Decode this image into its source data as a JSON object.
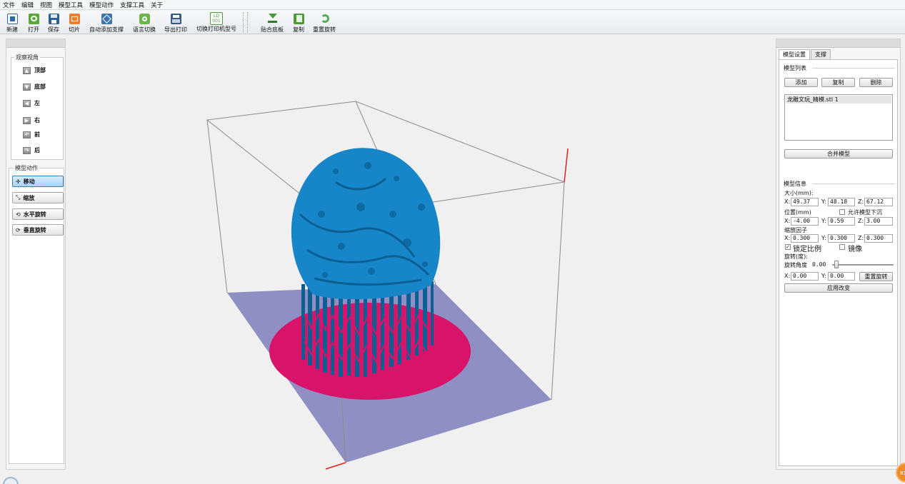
{
  "menu": [
    "文件",
    "编辑",
    "视图",
    "模型工具",
    "模型动作",
    "支撑工具",
    "关于"
  ],
  "toolbar": {
    "new": "新建",
    "open": "打开",
    "save": "保存",
    "slice": "切片",
    "auto_support": "自动添加支撑",
    "language": "语言切换",
    "export_print": "导出打印",
    "switch_printer": "切换打印机型号",
    "lay_flat": "贴合底板",
    "copy": "复制",
    "reset_rotation": "重置旋转",
    "printer_icon_text": "LD\n001",
    "colors": {
      "new": "#2e6aa8",
      "open": "#5aa83a",
      "save": "#2f5f8e",
      "slice": "#ee7d2d",
      "auto_support": "#3f74a8",
      "language": "#6ab44a",
      "export": "#3a5a80",
      "flat": "#4a9a3a",
      "copy": "#4f9a38",
      "reset": "#5aab55"
    }
  },
  "left_panel": {
    "view_group_title": "观察视角",
    "views": [
      "顶部",
      "底部",
      "左",
      "右",
      "前",
      "后"
    ],
    "action_group_title": "模型动作",
    "actions": [
      "移动",
      "缩放",
      "水平旋转",
      "垂直旋转"
    ]
  },
  "right_panel": {
    "tabs": [
      "模型设置",
      "支撑"
    ],
    "model_list_title": "模型列表",
    "add_button": "添加",
    "copy_button": "复制",
    "delete_button": "删除",
    "models": [
      "龙雕文玩_精模.stl 1"
    ],
    "merge_button": "合并模型",
    "model_info_title": "模型信息",
    "size_label": "大小(mm):",
    "size": {
      "x": "49.37",
      "y": "48.18",
      "z": "67.12"
    },
    "position_label": "位置(mm)",
    "allow_sink_label": "允许模型下沉",
    "position": {
      "x": "-4.00",
      "y": "0.59",
      "z": "3.00"
    },
    "scale_label": "缩放因子",
    "scale": {
      "x": "0.300",
      "y": "0.300",
      "z": "0.300"
    },
    "lock_ratio_label": "锁定比例",
    "mirror_label": "镜像",
    "rotation_label": "旋转(度):",
    "rotation_angle_label": "旋转角度",
    "rotation_angle": "0.00",
    "rotation": {
      "x": "0.00",
      "y": "0.00"
    },
    "reset_rotation_button": "重置旋转",
    "apply_button": "应用改变",
    "axis_x": "X:",
    "axis_y": "Y:",
    "axis_z": "Z:"
  },
  "viewport": {
    "colors": {
      "model": "#1686c9",
      "model_dark": "#0c5f93",
      "support_base": "#d7136a",
      "build_plate": "#8f8fc4",
      "box_edge": "#8a8a8a",
      "axis": "#e02020"
    }
  },
  "corner_badge": "81"
}
